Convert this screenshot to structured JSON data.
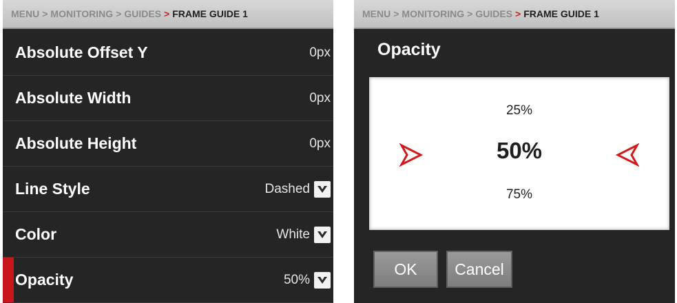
{
  "left": {
    "breadcrumb": {
      "items": [
        "MENU",
        "MONITORING",
        "GUIDES"
      ],
      "separator": ">",
      "current": "FRAME GUIDE 1"
    },
    "rows": [
      {
        "label": "Absolute Offset Y",
        "value": "0px"
      },
      {
        "label": "Absolute Width",
        "value": "0px"
      },
      {
        "label": "Absolute Height",
        "value": "0px"
      },
      {
        "label": "Line Style",
        "value": "Dashed",
        "icon": "chevron-down-icon"
      },
      {
        "label": "Color",
        "value": "White",
        "icon": "chevron-down-icon"
      },
      {
        "label": "Opacity",
        "value": "50%",
        "icon": "chevron-down-icon",
        "selected": true
      }
    ]
  },
  "right": {
    "breadcrumb": {
      "items": [
        "MENU",
        "MONITORING",
        "GUIDES"
      ],
      "separator": ">",
      "current": "FRAME GUIDE 1"
    },
    "title": "Opacity",
    "picker": {
      "previous": "25%",
      "current": "50%",
      "next": "75%"
    },
    "buttons": {
      "ok": "OK",
      "cancel": "Cancel"
    }
  },
  "colors": {
    "accent": "#c8161c",
    "panel_bg": "#252525",
    "breadcrumb_bg": "#cfcfcf",
    "button_bg": "#8c8c8c"
  }
}
